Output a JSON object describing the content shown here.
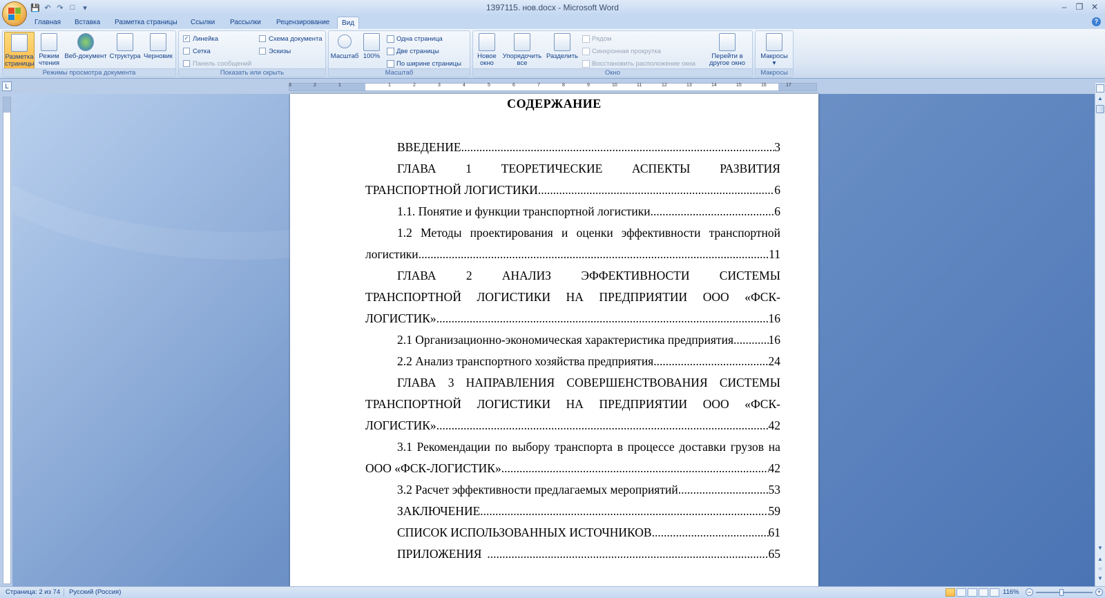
{
  "window": {
    "title": "1397115. нов.docx - Microsoft Word"
  },
  "tabs": [
    "Главная",
    "Вставка",
    "Разметка страницы",
    "Ссылки",
    "Рассылки",
    "Рецензирование",
    "Вид"
  ],
  "active_tab": "Вид",
  "ribbon": {
    "views": {
      "label": "Режимы просмотра документа",
      "print_layout": "Разметка страницы",
      "reading": "Режим чтения",
      "web": "Веб-документ",
      "outline": "Структура",
      "draft": "Черновик"
    },
    "show_hide": {
      "label": "Показать или скрыть",
      "ruler": "Линейка",
      "grid": "Сетка",
      "message_bar": "Панель сообщений",
      "doc_map": "Схема документа",
      "thumbnails": "Эскизы"
    },
    "zoom": {
      "label": "Масштаб",
      "zoom": "Масштаб",
      "hundred": "100%",
      "one_page": "Одна страница",
      "two_pages": "Две страницы",
      "page_width": "По ширине страницы"
    },
    "window": {
      "label": "Окно",
      "new_window": "Новое окно",
      "arrange_all": "Упорядочить все",
      "split": "Разделить",
      "side_by_side": "Рядом",
      "sync_scroll": "Синхронная прокрутка",
      "reset_position": "Восстановить расположение окна",
      "switch_windows": "Перейти в другое окно"
    },
    "macros": {
      "label": "Макросы",
      "macros": "Макросы"
    }
  },
  "document": {
    "title": "СОДЕРЖАНИЕ",
    "toc": [
      {
        "text": "ВВЕДЕНИЕ",
        "page": "3"
      },
      {
        "text": "ГЛАВА 1 ТЕОРЕТИЧЕСКИЕ АСПЕКТЫ РАЗВИТИЯ",
        "cont": "ТРАНСПОРТНОЙ ЛОГИСТИКИ",
        "page": "6"
      },
      {
        "text": "1.1. Понятие и функции транспортной логистики",
        "page": "6"
      },
      {
        "text": "1.2 Методы проектирования и оценки эффективности транспортной",
        "cont": "логистики",
        "page": "11"
      },
      {
        "text": "ГЛАВА 2 АНАЛИЗ ЭФФЕКТИВНОСТИ СИСТЕМЫ",
        "cont1": "ТРАНСПОРТНОЙ ЛОГИСТИКИ НА ПРЕДПРИЯТИИ ООО «ФСК-",
        "cont": "ЛОГИСТИК»",
        "page": "16"
      },
      {
        "text": "2.1 Организационно-экономическая характеристика предприятия",
        "page": "16"
      },
      {
        "text": "2.2 Анализ транспортного хозяйства предприятия",
        "page": "24"
      },
      {
        "text": "ГЛАВА 3 НАПРАВЛЕНИЯ СОВЕРШЕНСТВОВАНИЯ СИСТЕМЫ",
        "cont1": "ТРАНСПОРТНОЙ ЛОГИСТИКИ НА ПРЕДПРИЯТИИ ООО «ФСК-",
        "cont": "ЛОГИСТИК»",
        "page": "42"
      },
      {
        "text": "3.1 Рекомендации по выбору транспорта в процессе доставки грузов на",
        "cont": "ООО «ФСК-ЛОГИСТИК»",
        "page": "42"
      },
      {
        "text": "3.2 Расчет эффективности предлагаемых мероприятий",
        "page": "53"
      },
      {
        "text": "ЗАКЛЮЧЕНИЕ",
        "page": "59"
      },
      {
        "text": "СПИСОК ИСПОЛЬЗОВАННЫХ ИСТОЧНИКОВ",
        "page": "61"
      },
      {
        "text": "ПРИЛОЖЕНИЯ",
        "page": "65"
      }
    ]
  },
  "ruler_numbers": [
    "3",
    "2",
    "1",
    "1",
    "2",
    "3",
    "4",
    "5",
    "6",
    "7",
    "8",
    "9",
    "10",
    "11",
    "12",
    "13",
    "14",
    "15",
    "16",
    "17"
  ],
  "status": {
    "page": "Страница: 2 из 74",
    "language": "Русский (Россия)",
    "zoom": "116%"
  },
  "colors": {
    "accent": "#15428b",
    "ribbon_bg": "#dbe6f4",
    "active_button": "#fbb94a"
  }
}
